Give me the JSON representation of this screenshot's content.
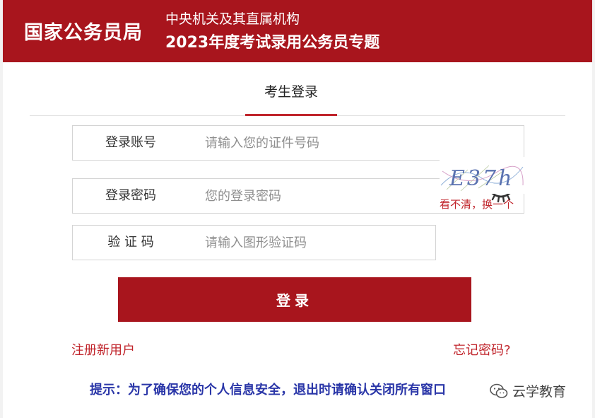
{
  "header": {
    "agency": "国家公务员局",
    "subtitle_line1": "中央机关及其直属机构",
    "subtitle_line2": "2023年度考试录用公务员专题"
  },
  "tabs": [
    {
      "label": "考生登录",
      "active": true
    }
  ],
  "form": {
    "account": {
      "label": "登录账号",
      "placeholder": "请输入您的证件号码",
      "value": ""
    },
    "password": {
      "label": "登录密码",
      "placeholder": "您的登录密码",
      "value": "",
      "toggle_icon": "eye-closed-icon"
    },
    "captcha": {
      "label": "验 证 码",
      "placeholder": "请输入图形验证码",
      "value": "",
      "image_text": "E37h",
      "refresh_label": "看不清，换一个"
    },
    "submit_label": "登录"
  },
  "links": {
    "register": "注册新用户",
    "forgot": "忘记密码?"
  },
  "tip": "提示：为了确保您的个人信息安全，退出时请确认关闭所有窗口",
  "watermark": {
    "text": "云学教育",
    "icon": "wechat-icon"
  },
  "colors": {
    "brand": "#a8151d",
    "accent": "#c0242b",
    "tip": "#2a36a8"
  }
}
